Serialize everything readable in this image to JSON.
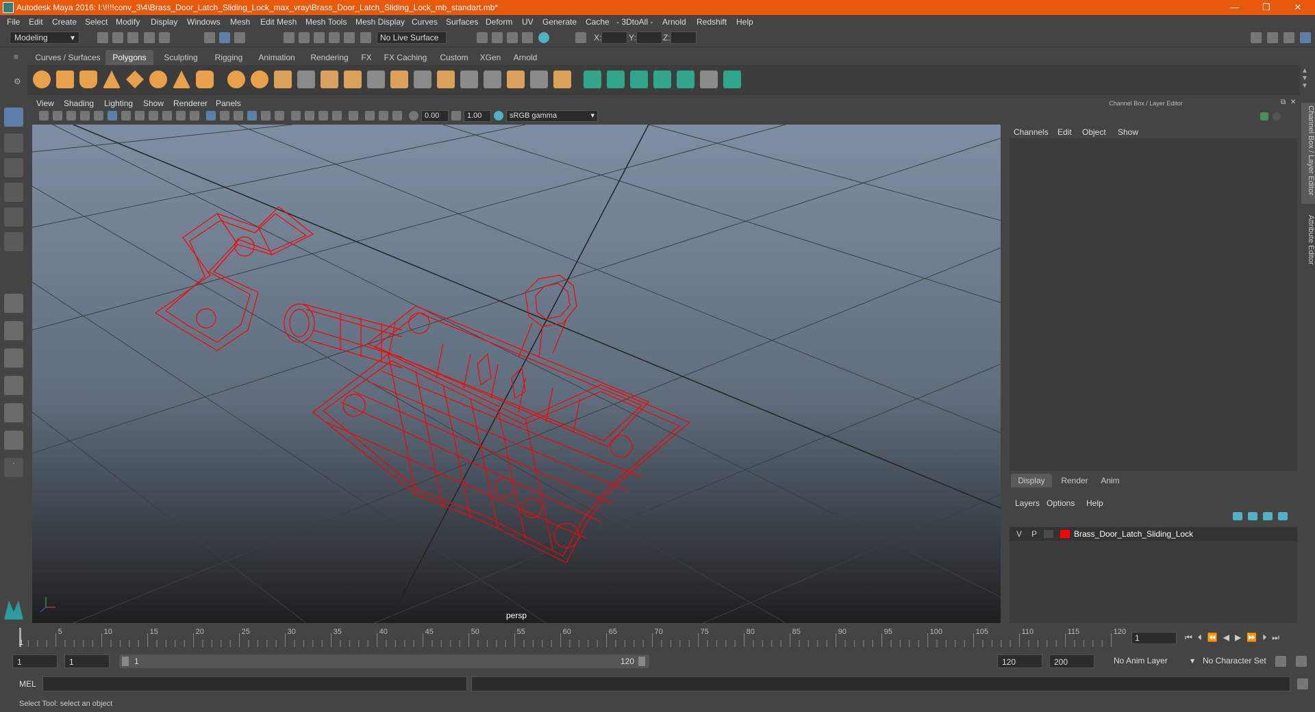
{
  "window": {
    "title": "Autodesk Maya 2016: I:\\!!!!conv_3\\4\\Brass_Door_Latch_Sliding_Lock_max_vray\\Brass_Door_Latch_Sliding_Lock_mb_standart.mb*",
    "minimize": "—",
    "maximize": "❐",
    "close": "✕"
  },
  "menubar": [
    "File",
    "Edit",
    "Create",
    "Select",
    "Modify",
    "Display",
    "Windows",
    "Mesh",
    "Edit Mesh",
    "Mesh Tools",
    "Mesh Display",
    "Curves",
    "Surfaces",
    "Deform",
    "UV",
    "Generate",
    "Cache",
    "- 3DtoAll -",
    "Arnold",
    "Redshift",
    "Help"
  ],
  "toolbar": {
    "mode": "Modeling",
    "live_surface": "No Live Surface",
    "x_label": "X:",
    "y_label": "Y:",
    "z_label": "Z:"
  },
  "shelf": {
    "tabs": [
      "Curves / Surfaces",
      "Polygons",
      "Sculpting",
      "Rigging",
      "Animation",
      "Rendering",
      "FX",
      "FX Caching",
      "Custom",
      "XGen",
      "Arnold"
    ],
    "active_tab": "Polygons"
  },
  "viewport": {
    "menu": [
      "View",
      "Shading",
      "Lighting",
      "Show",
      "Renderer",
      "Panels"
    ],
    "exposure": "0.00",
    "gamma": "1.00",
    "color_space": "sRGB gamma",
    "camera_label": "persp",
    "wire_color": "#ff0000"
  },
  "channel_box": {
    "header": "Channel Box / Layer Editor",
    "menu": [
      "Channels",
      "Edit",
      "Object",
      "Show"
    ]
  },
  "layer_editor": {
    "tabs": [
      "Display",
      "Render",
      "Anim"
    ],
    "active_tab": "Display",
    "menu": [
      "Layers",
      "Options",
      "Help"
    ],
    "layers": [
      {
        "v": "V",
        "p": "P",
        "color": "#ff0000",
        "name": "Brass_Door_Latch_Sliding_Lock"
      }
    ]
  },
  "side_tabs": [
    "Channel Box / Layer Editor",
    "Attribute Editor"
  ],
  "timeline": {
    "ticks": [
      "5",
      "10",
      "15",
      "20",
      "25",
      "30",
      "35",
      "40",
      "45",
      "50",
      "55",
      "60",
      "65",
      "70",
      "75",
      "80",
      "85",
      "90",
      "95",
      "100",
      "105",
      "110",
      "115",
      "120"
    ],
    "current_frame": "1",
    "start_marker": "1"
  },
  "range": {
    "start": "1",
    "playback_start": "1",
    "range_start_label": "1",
    "range_end_label": "120",
    "playback_end": "120",
    "end": "200",
    "anim_layer": "No Anim Layer",
    "character_set": "No Character Set"
  },
  "command": {
    "label": "MEL"
  },
  "help_line": "Select Tool: select an object"
}
